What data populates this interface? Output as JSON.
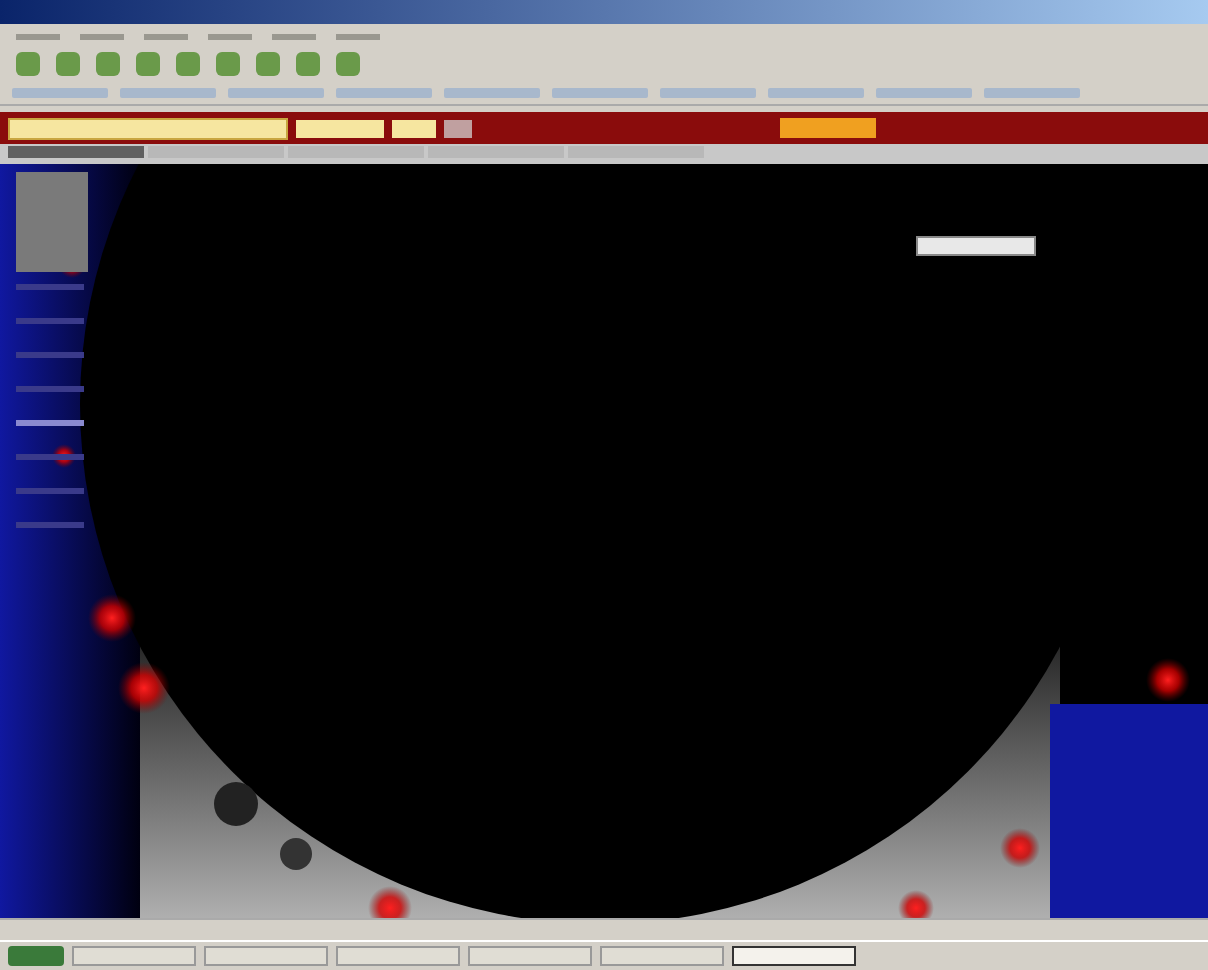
{
  "nav_tabs": [
    {
      "selected": true
    },
    {
      "selected": false
    },
    {
      "selected": false
    },
    {
      "selected": false
    },
    {
      "selected": false
    }
  ],
  "sidebar": {
    "items": [
      {
        "selected": false
      },
      {
        "selected": false
      },
      {
        "selected": false
      },
      {
        "selected": false
      },
      {
        "selected": true
      },
      {
        "selected": false
      },
      {
        "selected": false
      },
      {
        "selected": false
      }
    ]
  },
  "taskbar": {
    "buttons": [
      {
        "selected": false
      },
      {
        "selected": false
      },
      {
        "selected": false
      },
      {
        "selected": false
      },
      {
        "selected": false
      },
      {
        "selected": true
      }
    ]
  }
}
